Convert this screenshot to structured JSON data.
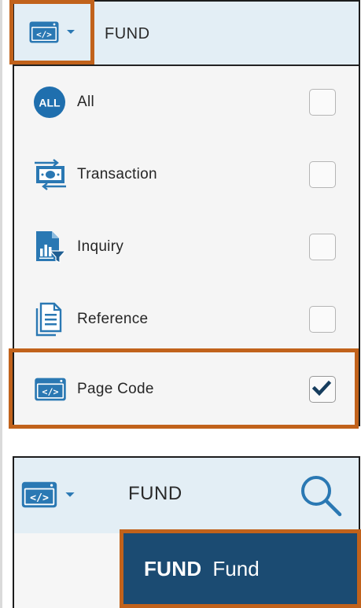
{
  "filter_dropdown": {
    "header_text": "FUND",
    "options": [
      {
        "label": "All",
        "icon": "all-icon",
        "checked": false
      },
      {
        "label": "Transaction",
        "icon": "transaction-icon",
        "checked": false
      },
      {
        "label": "Inquiry",
        "icon": "inquiry-icon",
        "checked": false
      },
      {
        "label": "Reference",
        "icon": "reference-icon",
        "checked": false
      },
      {
        "label": "Page Code",
        "icon": "page-code-icon",
        "checked": true
      }
    ]
  },
  "search_bar": {
    "text": "FUND",
    "search_icon": "search-icon"
  },
  "result": {
    "code": "FUND",
    "name": "Fund"
  },
  "colors": {
    "accent_blue": "#2a78b3",
    "highlight_orange": "#c1621b",
    "result_bg": "#1b4b72",
    "header_bg": "#e3eef5"
  },
  "all_badge_text": "ALL"
}
